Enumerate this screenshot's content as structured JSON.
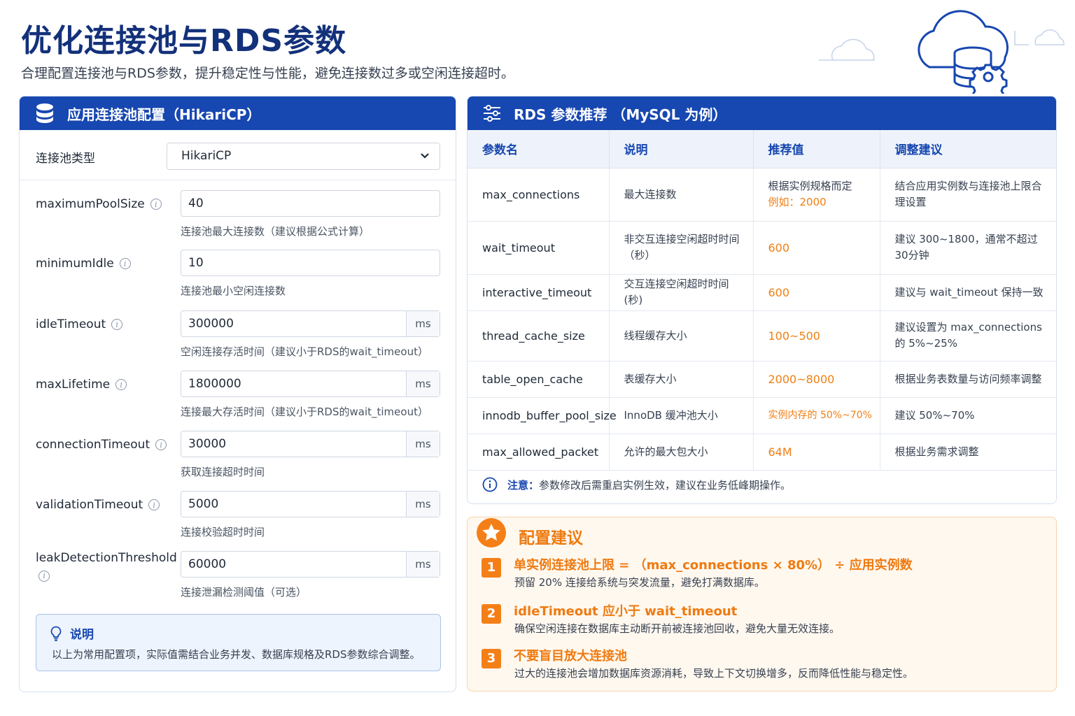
{
  "page": {
    "title": "优化连接池与RDS参数",
    "subtitle": "合理配置连接池与RDS参数，提升稳定性与性能，避免连接数过多或空闲连接超时。"
  },
  "left_panel": {
    "title": "应用连接池配置（HikariCP）",
    "pool_type_label": "连接池类型",
    "pool_type_value": "HikariCP",
    "params": [
      {
        "label": "maximumPoolSize",
        "value": "40",
        "unit": "",
        "help": "连接池最大连接数（建议根据公式计算）"
      },
      {
        "label": "minimumIdle",
        "value": "10",
        "unit": "",
        "help": "连接池最小空闲连接数"
      },
      {
        "label": "idleTimeout",
        "value": "300000",
        "unit": "ms",
        "help": "空闲连接存活时间（建议小于RDS的wait_timeout）"
      },
      {
        "label": "maxLifetime",
        "value": "1800000",
        "unit": "ms",
        "help": "连接最大存活时间（建议小于RDS的wait_timeout）"
      },
      {
        "label": "connectionTimeout",
        "value": "30000",
        "unit": "ms",
        "help": "获取连接超时时间"
      },
      {
        "label": "validationTimeout",
        "value": "5000",
        "unit": "ms",
        "help": "连接校验超时时间"
      },
      {
        "label": "leakDetectionThreshold",
        "value": "60000",
        "unit": "ms",
        "help": "连接泄漏检测阈值（可选）"
      }
    ],
    "note_title": "说明",
    "note_text": "以上为常用配置项，实际值需结合业务并发、数据库规格及RDS参数综合调整。"
  },
  "rds_panel": {
    "title": "RDS 参数推荐 （MySQL 为例）",
    "columns": [
      "参数名",
      "说明",
      "推荐值",
      "调整建议"
    ],
    "rows": [
      {
        "name": "max_connections",
        "desc": "最大连接数",
        "value": "根据实例规格而定",
        "value_extra": "例如：2000",
        "advice": "结合应用实例数与连接池上限合理设置"
      },
      {
        "name": "wait_timeout",
        "desc": "非交互连接空闲超时时间（秒）",
        "value": "600",
        "value_extra": "",
        "advice": "建议 300~1800，通常不超过30分钟"
      },
      {
        "name": "interactive_timeout",
        "desc": "交互连接空闲超时时间(秒)",
        "value": "600",
        "value_extra": "",
        "advice": "建议与 wait_timeout 保持一致"
      },
      {
        "name": "thread_cache_size",
        "desc": "线程缓存大小",
        "value": "100~500",
        "value_extra": "",
        "advice": "建议设置为 max_connections 的 5%~25%"
      },
      {
        "name": "table_open_cache",
        "desc": "表缓存大小",
        "value": "2000~8000",
        "value_extra": "",
        "advice": "根据业务表数量与访问频率调整"
      },
      {
        "name": "innodb_buffer_pool_size",
        "desc": "InnoDB 缓冲池大小",
        "value": "实例内存的 50%~70%",
        "value_extra": "",
        "advice": "建议 50%~70%"
      },
      {
        "name": "max_allowed_packet",
        "desc": "允许的最大包大小",
        "value": "64M",
        "value_extra": "",
        "advice": "根据业务需求调整"
      }
    ],
    "note_label": "注意：",
    "note_text": "参数修改后需重启实例生效，建议在业务低峰期操作。"
  },
  "advice_panel": {
    "title": "配置建议",
    "items": [
      {
        "num": "1",
        "head": "单实例连接池上限 = （max_connections × 80%） ÷ 应用实例数",
        "desc": "预留 20% 连接给系统与突发流量，避免打满数据库。"
      },
      {
        "num": "2",
        "head": "idleTimeout 应小于 wait_timeout",
        "desc": "确保空闲连接在数据库主动断开前被连接池回收，避免大量无效连接。"
      },
      {
        "num": "3",
        "head": "不要盲目放大连接池",
        "desc": "过大的连接池会增加数据库资源消耗，导致上下文切换增多，反而降低性能与稳定性。"
      }
    ]
  },
  "colors": {
    "primary": "#1747b0",
    "accent": "#f07f13",
    "title": "#13317a"
  },
  "icons": [
    "cloud-database-gear-icon",
    "database-icon",
    "sliders-icon",
    "chevron-down-icon",
    "info-icon",
    "lightbulb-icon",
    "star-icon"
  ]
}
